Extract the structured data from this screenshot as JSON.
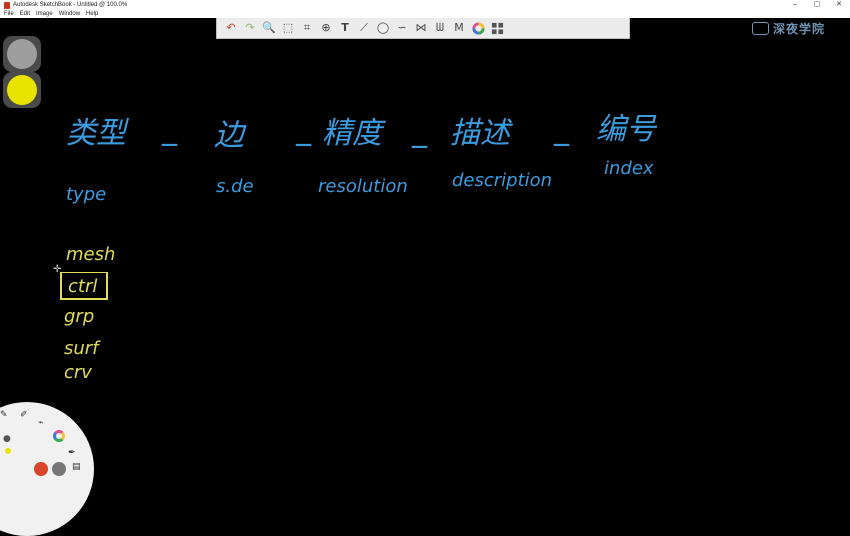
{
  "window": {
    "title": "Autodesk SketchBook - Untitled @ 100.0%",
    "controls": [
      "–",
      "▢",
      "✕"
    ]
  },
  "menu": [
    "File",
    "Edit",
    "Image",
    "Window",
    "Help"
  ],
  "toolbar": {
    "undo": "↶",
    "redo": "↷",
    "zoom": "🔍",
    "select": "⬚",
    "crop": "⌗",
    "transform": "⊕",
    "text": "T",
    "ruler": "⟋",
    "ellipse": "◯",
    "french-curve": "∽",
    "symmetry": "⋈",
    "brush-palette": "ᗯ",
    "copic": "M"
  },
  "watermark": {
    "text": "深夜学院"
  },
  "colors": {
    "top_swatch": "#9e9e9e",
    "bottom_swatch": "#e8e400",
    "ink_blue": "#3b9bdf",
    "ink_yellow": "#e3dc57"
  },
  "sketch": {
    "row1": [
      "类型",
      "_",
      "边",
      "_",
      "精度",
      "_",
      "描述",
      "_",
      "编号"
    ],
    "row2": [
      "type",
      "s.de",
      "resolution",
      "description",
      "index"
    ],
    "list": [
      "mesh",
      "ctrl",
      "grp",
      "surf",
      "crv"
    ]
  }
}
